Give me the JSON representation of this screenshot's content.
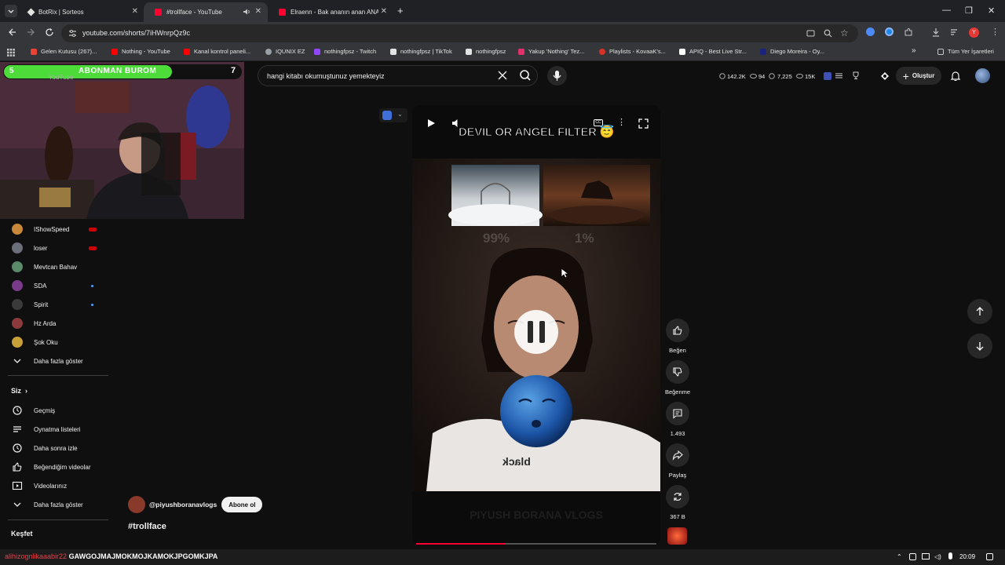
{
  "browser": {
    "tabs": [
      {
        "title": "BotRix | Sorteos",
        "active": false
      },
      {
        "title": "#trollface - YouTube",
        "active": true
      },
      {
        "title": "Elraenn - Bak ananın anan ANA",
        "active": false
      }
    ],
    "url": "youtube.com/shorts/7iHWnrpQz9c",
    "bookmarks": [
      {
        "label": "Gelen Kutusu (267)...",
        "color": "#ea4335"
      },
      {
        "label": "Nothing - YouTube",
        "color": "#ff0000"
      },
      {
        "label": "Kanal kontrol paneli...",
        "color": "#ff0000"
      },
      {
        "label": "IQUNIX EZ",
        "color": "#9aa0a6"
      },
      {
        "label": "nothingfpsz - Twitch",
        "color": "#9146ff"
      },
      {
        "label": "nothingfpsz | TikTok",
        "color": "#e3e3e3"
      },
      {
        "label": "nothingfpsz",
        "color": "#e3e3e3"
      },
      {
        "label": "Yakup 'Nothing' Tez...",
        "color": "#e1306c"
      },
      {
        "label": "Playlists - KovaaK's...",
        "color": "#d93025"
      },
      {
        "label": "APIQ - Best Live Str...",
        "color": "#ffffff"
      },
      {
        "label": "Diego Moreira - Oy...",
        "color": "#1a237e"
      }
    ],
    "all_bookmarks": "Tüm Yer İşaretleri"
  },
  "youtube": {
    "search_value": "hangi kitabı okumuştunuz yemekteyiz",
    "stats": [
      "142.2K",
      "94",
      "7,225",
      "15K"
    ],
    "create_label": "Oluştur",
    "sidebar": {
      "subscriptions": [
        {
          "name": "IShowSpeed",
          "badge": "live",
          "color": "#c8883a"
        },
        {
          "name": "loser",
          "badge": "live",
          "color": "#6a6f78"
        },
        {
          "name": "Mevtcan Bahav",
          "badge": "",
          "color": "#5a8a6a"
        },
        {
          "name": "SDA",
          "badge": "dot",
          "color": "#7a3a8a"
        },
        {
          "name": "Spirit",
          "badge": "dot",
          "color": "#3a3a3a"
        },
        {
          "name": "Hz Arda",
          "badge": "",
          "color": "#8a3a3a"
        },
        {
          "name": "Şok Oku",
          "badge": "",
          "color": "#c8a03a"
        }
      ],
      "show_more": "Daha fazla göster",
      "you_heading": "Siz",
      "you_items": [
        "Geçmiş",
        "Oynatma listeleri",
        "Daha sonra izle",
        "Beğendiğim videolar",
        "Videolarınız"
      ],
      "show_more_2": "Daha fazla göster",
      "explore_heading": "Keşfet"
    },
    "overlay": {
      "sub_left": "5",
      "sub_label": "ABONMAN BUROM",
      "sub_right": "7",
      "logo_text": "YouTube"
    },
    "video": {
      "title": "DEVIL OR ANGEL FILTER",
      "title_emoji": "😇",
      "left_pct": "99%",
      "right_pct": "1%",
      "shirt_text": "black",
      "watermark": "PIYUSH BORANA VLOGS",
      "progress": 0.37
    },
    "actions": {
      "like": "Beğen",
      "dislike": "Beğenme",
      "comments": "1.493",
      "share": "Paylaş",
      "remix": "367 B"
    },
    "channel_name": "@piyushboranavlogs",
    "subscribe_label": "Abone ol",
    "hashtag": "#trollface"
  },
  "taskbar": {
    "ticker_red": "alihizognlikaaabir22",
    "ticker_white": "GAWGOJMAJMOKMOJKAMOKJPGOMKJPA",
    "time": "20:09"
  }
}
